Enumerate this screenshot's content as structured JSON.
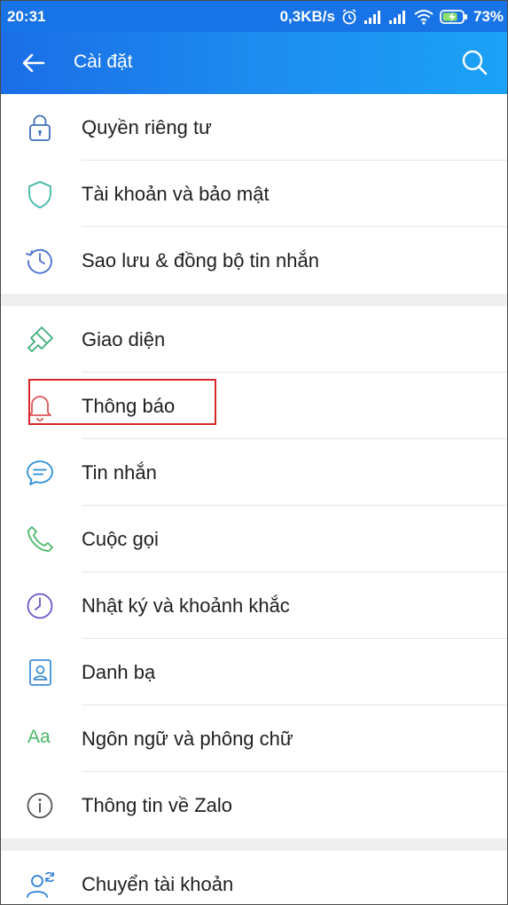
{
  "status_bar": {
    "time": "20:31",
    "network_speed": "0,3KB/s",
    "battery_percent": "73%",
    "icons": [
      "alarm-icon",
      "signal-icon",
      "signal-icon",
      "wifi-icon",
      "battery-charging-icon"
    ]
  },
  "header": {
    "title": "Cài đặt",
    "back_icon": "arrow-left-icon",
    "search_icon": "search-icon"
  },
  "groups": [
    {
      "items": [
        {
          "label": "Quyền riêng tư",
          "icon": "lock-icon"
        },
        {
          "label": "Tài khoản và bảo mật",
          "icon": "shield-icon"
        },
        {
          "label": "Sao lưu & đồng bộ tin nhắn",
          "icon": "history-icon"
        }
      ]
    },
    {
      "items": [
        {
          "label": "Giao diện",
          "icon": "paint-brush-icon"
        },
        {
          "label": "Thông báo",
          "icon": "bell-icon",
          "highlighted": true
        },
        {
          "label": "Tin nhắn",
          "icon": "chat-icon"
        },
        {
          "label": "Cuộc gọi",
          "icon": "phone-icon"
        },
        {
          "label": "Nhật ký và khoảnh khắc",
          "icon": "clock-icon"
        },
        {
          "label": "Danh bạ",
          "icon": "contact-icon"
        },
        {
          "label": "Ngôn ngữ và phông chữ",
          "icon": "font-icon",
          "icon_text": "Aa"
        },
        {
          "label": "Thông tin về Zalo",
          "icon": "info-icon"
        }
      ]
    },
    {
      "items": [
        {
          "label": "Chuyển tài khoản",
          "icon": "switch-account-icon"
        }
      ]
    }
  ],
  "colors": {
    "header_start": "#1b6ee6",
    "header_end": "#1ba2f6",
    "highlight": "#d8262b",
    "lock": "#3e6fb8",
    "shield": "#3fb8a8",
    "history": "#4a6fcf",
    "brush": "#3fae7a",
    "bell": "#e05555",
    "chat": "#2c8fd6",
    "phone": "#4cb86a",
    "clock": "#6b57c8",
    "contact": "#3e8fd6",
    "font": "#4cb86a",
    "info": "#555555",
    "switch": "#2c7fd6"
  }
}
